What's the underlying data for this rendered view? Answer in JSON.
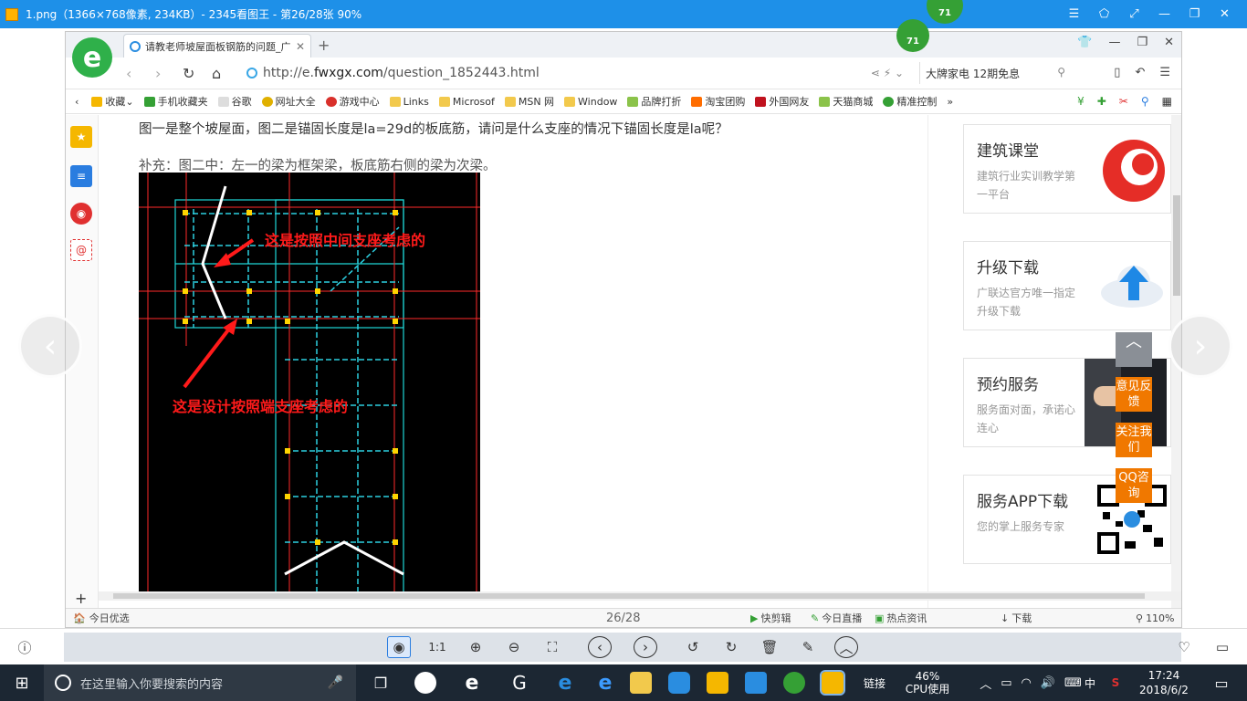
{
  "viewer": {
    "title": "1.png（1366×768像素, 234KB）- 2345看图王 - 第26/28张 90%",
    "badge": "71",
    "page_counter": "26/28"
  },
  "browser": {
    "badge": "71",
    "tab_title": "请教老师坡屋面板钢筋的问题_广",
    "url_prefix": "http://e.",
    "url_domain": "fwxgx.com",
    "url_path": "/question_1852443.html",
    "search_text": "大牌家电 12期免息",
    "bookmarks": [
      "收藏",
      "手机收藏夹",
      "谷歌",
      "网址大全",
      "游戏中心",
      "Links",
      "Microsof",
      "MSN 网",
      "Window",
      "品牌打折",
      "淘宝团购",
      "外国网友",
      "天猫商城",
      "精准控制"
    ]
  },
  "article": {
    "question": "图一是整个坡屋面，图二是锚固长度是la=29d的板底筋，请问是什么支座的情况下锚固长度是la呢？",
    "supplement": "补充：图二中：左一的梁为框架梁，板底筋右侧的梁为次梁。",
    "annotation_1": "这是按照中间支座考虑的",
    "annotation_2": "这是设计按照端支座考虑的"
  },
  "sidebar_cards": [
    {
      "title": "建筑课堂",
      "subtitle": "建筑行业实训教学第一平台"
    },
    {
      "title": "升级下载",
      "subtitle": "广联达官方唯一指定升级下载"
    },
    {
      "title": "预约服务",
      "subtitle": "服务面对面，承诺心连心"
    },
    {
      "title": "服务APP下载",
      "subtitle": "您的掌上服务专家"
    }
  ],
  "float_buttons": {
    "feedback": "意见反馈",
    "follow": "关注我们",
    "qq": "QQ咨询"
  },
  "statusbar": {
    "today_pick": "今日优选",
    "quick_cut": "快剪辑",
    "today_live": "今日直播",
    "hot_news": "热点资讯",
    "download": "下载",
    "zoom": "110%"
  },
  "taskbar": {
    "search_placeholder": "在这里输入你要搜索的内容",
    "network": "链接",
    "cpu_value": "46%",
    "cpu_label": "CPU使用",
    "ime": "中",
    "time": "17:24",
    "date": "2018/6/2"
  },
  "colors": {
    "titlebar": "#1e90e8",
    "accent_orange": "#f07800",
    "annotation_red": "#ff1a1a",
    "taskbar": "#1c2733"
  }
}
